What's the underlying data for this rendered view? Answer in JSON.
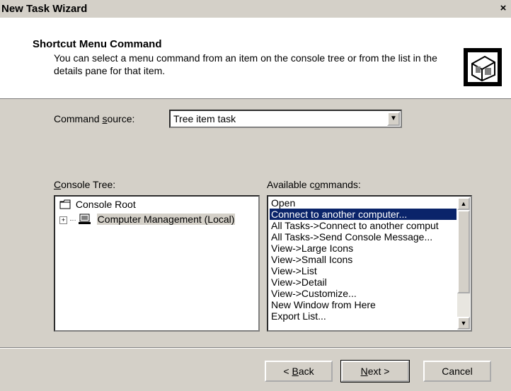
{
  "window": {
    "title": "New Task Wizard",
    "close": "×"
  },
  "header": {
    "title": "Shortcut Menu Command",
    "description": "You can select a menu command from an item on the console tree or from the list in the details pane for that item.",
    "icon": "wizard-icon"
  },
  "command_source": {
    "label_pre": "Command ",
    "label_key": "s",
    "label_post": "ource:",
    "value": "Tree item task"
  },
  "console_tree": {
    "label_key": "C",
    "label_post": "onsole Tree:",
    "items": [
      {
        "label": "Console Root",
        "icon": "folder-icon"
      },
      {
        "label": "Computer Management (Local)",
        "icon": "computer-icon",
        "expander": "+"
      }
    ]
  },
  "available_commands": {
    "label_pre": "Available c",
    "label_key": "o",
    "label_post": "mmands:",
    "items": [
      "Open",
      "Connect to another computer...",
      "All Tasks->Connect to another comput",
      "All Tasks->Send Console Message...",
      "View->Large Icons",
      "View->Small Icons",
      "View->List",
      "View->Detail",
      "View->Customize...",
      "New Window from Here",
      "Export List..."
    ],
    "selected_index": 1
  },
  "buttons": {
    "back_pre": "< ",
    "back_key": "B",
    "back_post": "ack",
    "next_key": "N",
    "next_post": "ext >",
    "cancel": "Cancel"
  }
}
